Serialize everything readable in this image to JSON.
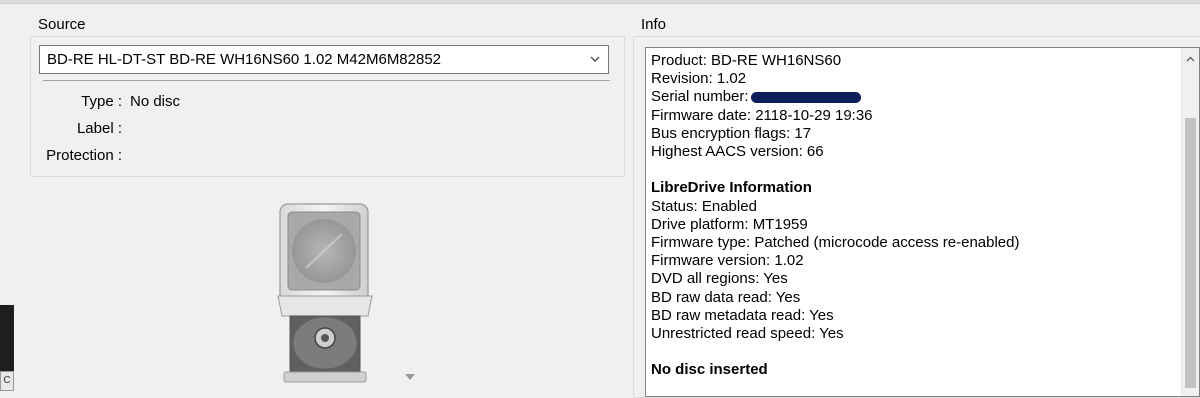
{
  "source": {
    "title": "Source",
    "drive_selected": "BD-RE HL-DT-ST BD-RE  WH16NS60 1.02 M42M6M82852",
    "type_label": "Type :",
    "type_value": "No disc",
    "label_label": "Label :",
    "protection_label": "Protection :"
  },
  "info": {
    "title": "Info",
    "product": "Product: BD-RE WH16NS60",
    "revision": "Revision: 1.02",
    "serial_label": "Serial number:",
    "firmware_date": "Firmware date: 2118-10-29 19:36",
    "bus_encryption": "Bus encryption flags: 17",
    "highest_aacs": "Highest AACS version: 66",
    "libredrive_heading": "LibreDrive Information",
    "status": "Status: Enabled",
    "drive_platform": "Drive platform: MT1959",
    "firmware_type": "Firmware type: Patched (microcode access re-enabled)",
    "firmware_version": "Firmware version: 1.02",
    "dvd_regions": "DVD all regions: Yes",
    "bd_raw_read": "BD raw data read: Yes",
    "bd_raw_metadata": "BD raw metadata read: Yes",
    "unrestricted_speed": "Unrestricted read speed: Yes",
    "no_disc": "No disc inserted"
  },
  "taskbar_chip": "C",
  "colors": {
    "redaction": "#0d1f5a",
    "window_bg": "#f0f0f0"
  }
}
